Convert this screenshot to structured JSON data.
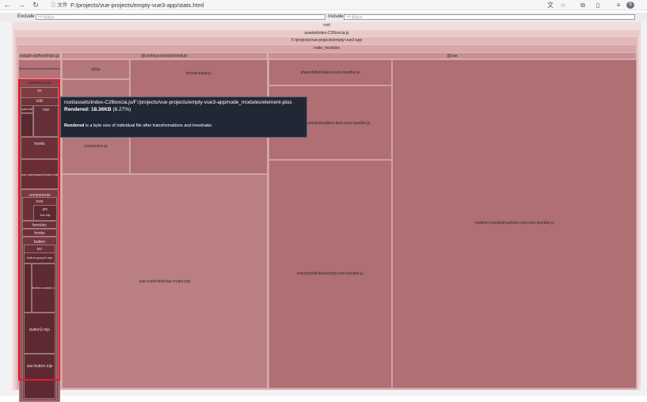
{
  "browser": {
    "security_label": "文件",
    "url": "F:/projects/vue-projects/empty-vue3-app/stats.html",
    "avatar_initial": "S"
  },
  "filters": {
    "exclude_label": "Exclude",
    "exclude_placeholder": "**/*.[hi]s.js",
    "include_label": "Include",
    "include_placeholder": "**/*.[hi]s.js"
  },
  "tree": {
    "root": "root",
    "assets": "assets/index-C26ixxcia.js",
    "project": "F:/projects/vue-projects/empty-vue3-app",
    "node_modules": "node_modules",
    "lodash": "lodash-es/fromPairs.js",
    "tinycolor": "@ctrl/tinycolor/dist/module",
    "vue": "@vue",
    "util": "util.js",
    "format_input": "format-input.js",
    "conversion": "conversion.js",
    "vue_router": "vue-router/dist/vue-router.mjs",
    "shared": "shared/dist/shared.esm-bundler.js",
    "runtime_dom": "runtime-dom/dist/runtime-dom.esm-bundler.js",
    "reactivity": "reactivity/dist/reactivity.esm-bundler.js",
    "runtime_core": "runtime-core/dist/runtime-core.esm-bundler.js",
    "ep_plugin": "@element-plus/icons-vue/dist/index.js",
    "element_plus": "element-plus",
    "es": "es",
    "utils": "utils",
    "types": "types.mjs",
    "vue_dir": "vue",
    "hooks": "hooks",
    "use_namespace": "use-namespace/index.mjs",
    "components": "components",
    "icon": "icon",
    "src": "src",
    "icon_mjs": "icon.mjs",
    "form_src": "form/src",
    "hooks2": "hooks",
    "button": "button",
    "button_src": "src",
    "button_group": "button-group2.mjs",
    "button_custom": "button-custom.mjs",
    "button2": "button2.mjs",
    "use_button": "use-button.mjs"
  },
  "tooltip": {
    "path": "root/assets/index-C26ixxcia.js/F:/projects/vue-projects/empty-vue3-app/node_modules/element-plus",
    "rendered_label": "Rendered:",
    "rendered_value": "18.36KB",
    "rendered_percent": "(6.27%)",
    "note_bold": "Rendered",
    "note_rest": "is a byte size of individual file after transformations and treeshake."
  },
  "colors": {
    "base": "#b0686c",
    "header_light": "#e6c1c1",
    "dark": "#7e3c43",
    "highlight": "#e11d2a"
  }
}
